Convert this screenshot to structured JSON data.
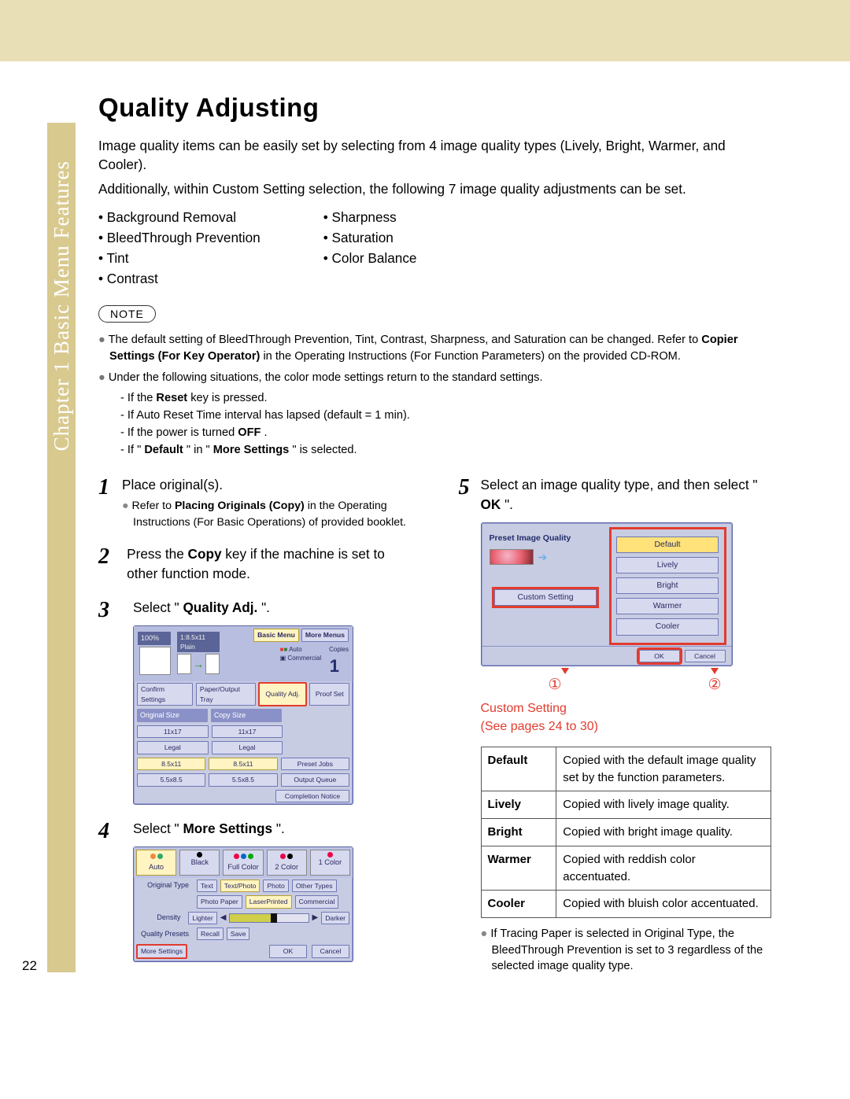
{
  "sidebar": "Chapter 1   Basic Menu Features",
  "title": "Quality Adjusting",
  "intro1": "Image quality items can be easily set by selecting from 4 image quality types (Lively, Bright, Warmer, and Cooler).",
  "intro2": "Additionally, within Custom Setting selection, the following 7 image quality adjustments can be set.",
  "adj_left": [
    "Background Removal",
    "BleedThrough Prevention",
    "Tint",
    "Contrast"
  ],
  "adj_right": [
    "Sharpness",
    "Saturation",
    "Color Balance"
  ],
  "note_label": "NOTE",
  "notes": {
    "n1": "The default setting of BleedThrough Prevention, Tint, Contrast, Sharpness, and Saturation can be changed. Refer to ",
    "n1b": "Copier Settings (For Key Operator)",
    "n1c": " in the Operating Instructions (For Function Parameters) on the provided CD-ROM.",
    "n2": "Under the following situations, the color mode settings return to the standard settings.",
    "n2a": "- If the ",
    "n2a_b": "Reset",
    "n2a_c": " key is pressed.",
    "n2b": "- If Auto Reset Time interval has lapsed (default = 1 min).",
    "n2c_a": "- If the power is turned ",
    "n2c_b": "OFF",
    "n2c_c": ".",
    "n2d_a": "- If \"",
    "n2d_b": "Default",
    "n2d_c": "\" in \"",
    "n2d_d": "More Settings",
    "n2d_e": "\" is selected."
  },
  "steps": {
    "s1": {
      "txt": "Place original(s).",
      "sub_a": "Refer to ",
      "sub_b": "Placing Originals (Copy)",
      "sub_c": " in the Operating Instructions (For Basic Operations) of provided booklet."
    },
    "s2": {
      "a": "Press the ",
      "b": "Copy",
      "c": " key if the machine is set to other function mode."
    },
    "s3": {
      "a": "Select \"",
      "b": "Quality Adj.",
      "c": "\"."
    },
    "s4": {
      "a": "Select \"",
      "b": "More Settings",
      "c": "\"."
    },
    "s5": {
      "a": "Select an image quality type, and then select \"",
      "b": "OK",
      "c": "\"."
    }
  },
  "panel3": {
    "zoom": "100%",
    "paper": "1:8.5x11",
    "plain": "Plain",
    "tabs": [
      "Basic Menu",
      "More Menus"
    ],
    "auto": "Auto",
    "commercial": "Commercial",
    "copies": "Copies",
    "copies_n": "1",
    "btns": [
      "Confirm Settings",
      "Paper/Output Tray",
      "Quality Adj.",
      "Proof Set"
    ],
    "headers": [
      "Original Size",
      "Copy Size"
    ],
    "rows": [
      [
        "11x17",
        "11x17"
      ],
      [
        "Legal",
        "Legal"
      ],
      [
        "8.5x11",
        "8.5x11"
      ],
      [
        "5.5x8.5",
        "5.5x8.5"
      ]
    ],
    "right": [
      "Preset Jobs",
      "Output Queue",
      "Completion Notice"
    ]
  },
  "panel4": {
    "modes": [
      "Auto",
      "Black",
      "Full Color",
      "2 Color",
      "1 Color"
    ],
    "orig_label": "Original Type",
    "orig": [
      "Text",
      "Text/Photo",
      "Photo",
      "Other Types"
    ],
    "orig2": [
      "Photo Paper",
      "LaserPrinted",
      "Commercial"
    ],
    "dens": "Density",
    "lighter": "Lighter",
    "darker": "Darker",
    "qp": "Quality Presets",
    "recall": "Recall",
    "save": "Save",
    "more": "More Settings",
    "ok": "OK",
    "cancel": "Cancel"
  },
  "panel5": {
    "title": "Preset Image Quality",
    "btns": [
      "Default",
      "Lively",
      "Bright",
      "Warmer",
      "Cooler"
    ],
    "custom": "Custom Setting",
    "ok": "OK",
    "cancel": "Cancel",
    "circ1": "①",
    "circ2": "②",
    "caption": "Custom Setting",
    "caption2": "(See pages 24 to 30)"
  },
  "table": [
    {
      "k": "Default",
      "v": "Copied with the default image quality set by the function parameters."
    },
    {
      "k": "Lively",
      "v": "Copied with lively image quality."
    },
    {
      "k": "Bright",
      "v": "Copied with bright image quality."
    },
    {
      "k": "Warmer",
      "v": "Copied with reddish color accentuated."
    },
    {
      "k": "Cooler",
      "v": "Copied with bluish color accentuated."
    }
  ],
  "after": "If Tracing Paper is selected in Original Type, the BleedThrough Prevention is set to 3 regardless of the selected image quality type.",
  "page_no": "22"
}
